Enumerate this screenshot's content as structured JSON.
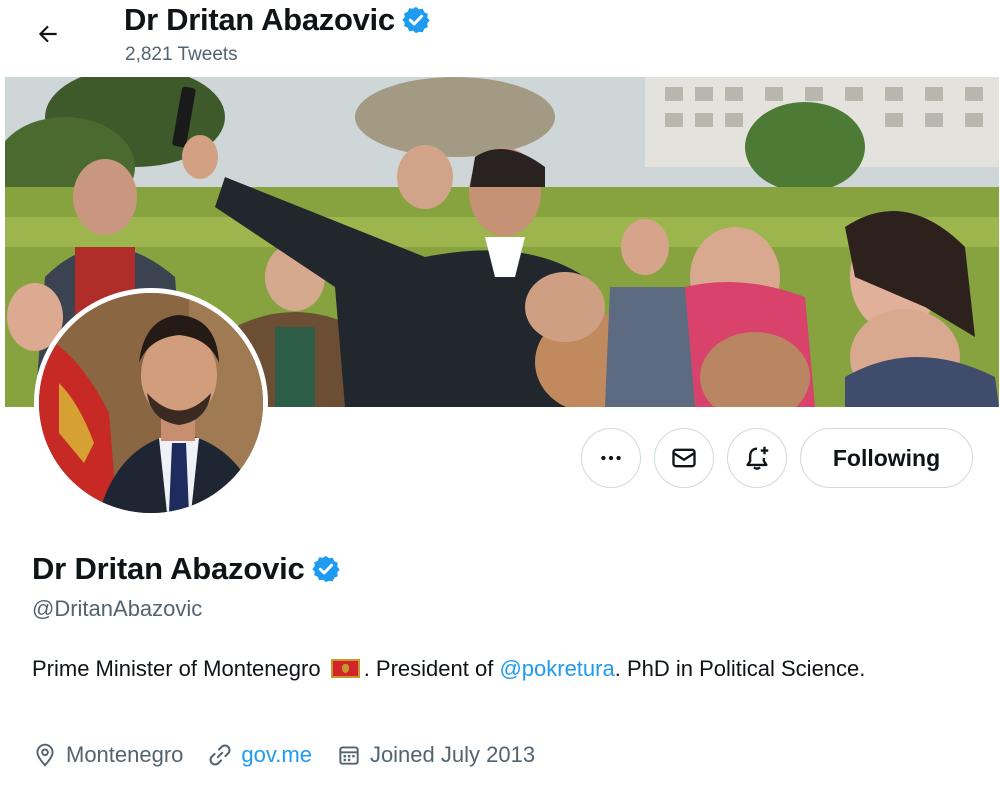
{
  "header": {
    "name": "Dr Dritan Abazovic",
    "tweet_count": "2,821 Tweets"
  },
  "actions": {
    "more_label": "more",
    "message_label": "message",
    "notify_label": "notifications",
    "following_label": "Following"
  },
  "profile": {
    "name": "Dr Dritan Abazovic",
    "handle": "@DritanAbazovic",
    "bio_part1": "Prime Minister of Montenegro",
    "bio_part2": ". President of ",
    "bio_mention": "@pokretura",
    "bio_part3": ". PhD in Political Science.",
    "location": "Montenegro",
    "website": "gov.me",
    "joined": "Joined July 2013"
  },
  "icons": {
    "back": "arrow-left-icon",
    "verified": "verified-badge-icon",
    "more": "more-horizontal-icon",
    "message": "mail-icon",
    "notify": "bell-plus-icon",
    "location": "location-pin-icon",
    "link": "link-icon",
    "calendar": "calendar-icon"
  },
  "colors": {
    "accent": "#1d9bf0",
    "secondary_text": "#536471",
    "border": "#cfd9de",
    "flag_red": "#d3232b",
    "flag_gold": "#c39a2b"
  }
}
